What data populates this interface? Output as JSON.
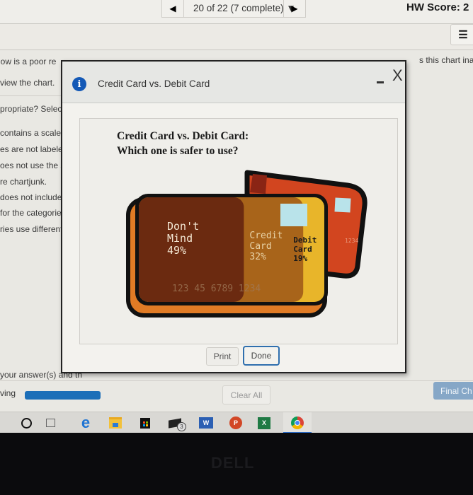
{
  "topbar": {
    "prev_icon": "◀",
    "question_nav_label": "20 of 22 (7 complete) ▼",
    "next_icon": "▶",
    "hw_score_label": "HW Score: 2",
    "menu_icon": "☰"
  },
  "question": {
    "line1_left": "low is a poor re",
    "line1_right": "s this chart ina",
    "line2": "view the chart.",
    "line3": "propriate? Selec",
    "options": [
      "contains a scale.",
      "es are not labele",
      "oes not use the si",
      "re chartjunk.",
      "does not include a",
      "for the categories",
      "ries use different u"
    ],
    "instruction": "your answer(s) and th"
  },
  "modal": {
    "title": "Credit Card vs. Debit Card",
    "minimize_label": "–",
    "close_label": "X",
    "figure_title_line1": "Credit Card vs. Debit Card:",
    "figure_title_line2": "Which one is safer to use?",
    "print_label": "Print",
    "done_label": "Done"
  },
  "chart_data": {
    "type": "pie",
    "title": "Credit Card vs. Debit Card: Which one is safer to use?",
    "categories": [
      "Don't Mind",
      "Credit Card",
      "Debit Card"
    ],
    "values": [
      49,
      32,
      19
    ],
    "unit": "%",
    "labels": [
      {
        "line1": "Don't",
        "line2": "Mind",
        "value": "49%"
      },
      {
        "line1": "Credit",
        "line2": "Card",
        "value": "32%"
      },
      {
        "line1": "Debit",
        "line2": "Card",
        "value": "19%"
      }
    ],
    "colors": [
      "#6b2a10",
      "#a8641a",
      "#e8b52a"
    ],
    "decorative_card_number": "123 45 6789 1234",
    "back_card_number": "1234",
    "back_card_color": "#d2451f"
  },
  "bottom": {
    "progress_label": "ving",
    "progress_fraction": 1.0,
    "clear_all_label": "Clear All",
    "final_check_label": "Final Ch"
  },
  "taskbar": {
    "items": [
      {
        "name": "cortana-search",
        "glyph": "O"
      },
      {
        "name": "task-view",
        "glyph": "⌷"
      },
      {
        "name": "edge",
        "glyph": "e"
      },
      {
        "name": "file-explorer",
        "glyph": ""
      },
      {
        "name": "store",
        "glyph": ""
      },
      {
        "name": "mail",
        "glyph": "✉",
        "badge": "3"
      },
      {
        "name": "word",
        "glyph": "W"
      },
      {
        "name": "powerpoint",
        "glyph": "P"
      },
      {
        "name": "excel",
        "glyph": "X"
      },
      {
        "name": "chrome",
        "glyph": ""
      }
    ]
  },
  "bezel": {
    "brand": "DELL"
  }
}
